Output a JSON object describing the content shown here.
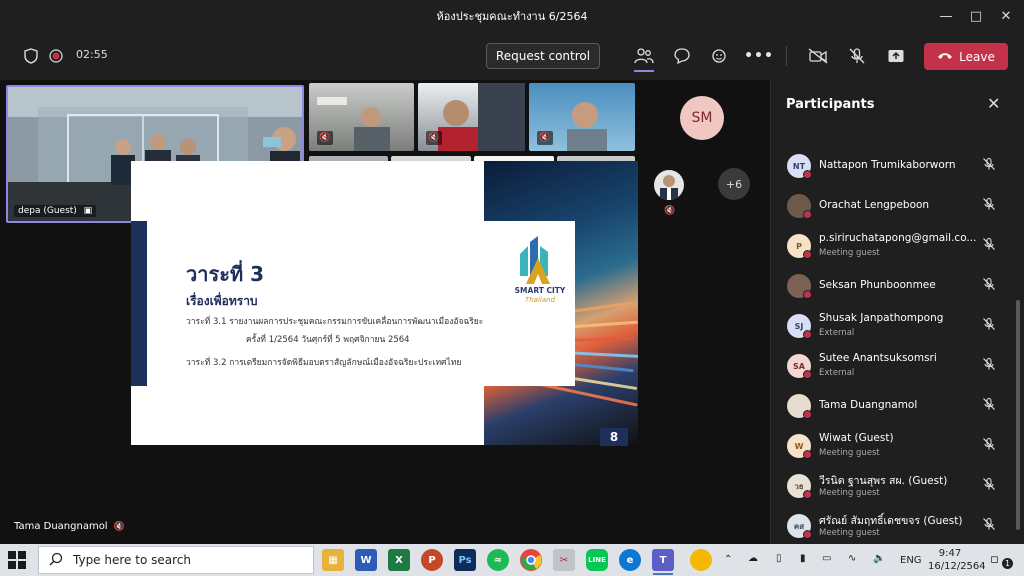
{
  "window": {
    "title": "ห้องประชุมคณะทำงาน 6/2564",
    "minimize_icon": "minimize-icon",
    "maximize_icon": "maximize-icon",
    "close_icon": "close-icon"
  },
  "toolbar": {
    "timer": "02:55",
    "request_control": "Request control",
    "leave": "Leave"
  },
  "stage": {
    "main_tile_label": "depa (Guest)",
    "avatar_initials": "SM",
    "overflow_count": "+6",
    "presenter_name": "Tama Duangnamol"
  },
  "slide": {
    "agenda_title": "วาระที่ 3",
    "agenda_subtitle": "เรื่องเพื่อทราบ",
    "line1": "วาระที่ 3.1 รายงานผลการประชุมคณะกรรมการขับเคลื่อนการพัฒนาเมืองอัจฉริยะ",
    "line2": "ครั้งที่ 1/2564 วันศุกร์ที่ 5 พฤศจิกายน 2564",
    "line3": "วาระที่ 3.2 การเตรียมการจัดพิธีมอบตราสัญลักษณ์เมืองอัจฉริยะประเทศไทย",
    "logo_text": "SMART CITY",
    "logo_subtext": "Thailand",
    "page_number": "8"
  },
  "panel": {
    "title": "Participants",
    "participants": [
      {
        "initials": "NT",
        "name": "Nattapon Trumikaborworn",
        "sub": "",
        "avatar_color": "#d9e0f5",
        "text_color": "#33406a"
      },
      {
        "initials": "",
        "name": "Orachat Lengpeboon",
        "sub": "",
        "avatar_color": "#6d5a4a",
        "text_color": "#fff"
      },
      {
        "initials": "P",
        "name": "p.siriruchatapong@gmail.co...",
        "sub": "Meeting guest",
        "avatar_color": "#f7e2c7",
        "text_color": "#8a5a1a"
      },
      {
        "initials": "",
        "name": "Seksan Phunboonmee",
        "sub": "",
        "avatar_color": "#7b6252",
        "text_color": "#fff"
      },
      {
        "initials": "SJ",
        "name": "Shusak Janpathompong",
        "sub": "External",
        "avatar_color": "#d9e0f5",
        "text_color": "#33406a"
      },
      {
        "initials": "SA",
        "name": "Sutee Anantsuksomsri",
        "sub": "External",
        "avatar_color": "#f4d6d3",
        "text_color": "#7b2a2a"
      },
      {
        "initials": "",
        "name": "Tama Duangnamol",
        "sub": "",
        "avatar_color": "#e7dccf",
        "text_color": "#333"
      },
      {
        "initials": "W",
        "name": "Wiwat (Guest)",
        "sub": "Meeting guest",
        "avatar_color": "#f7e2c7",
        "text_color": "#8a5a1a"
      },
      {
        "initials": "วธ",
        "name": "วีรนิต ฐานสุพร สผ. (Guest)",
        "sub": "Meeting guest",
        "avatar_color": "#e9e1d6",
        "text_color": "#5a4a3a"
      },
      {
        "initials": "คส",
        "name": "ศรัณย์ สัมฤทธิ์เดชขจร (Guest)",
        "sub": "Meeting guest",
        "avatar_color": "#dfe3ea",
        "text_color": "#3a4a5a"
      }
    ]
  },
  "taskbar": {
    "search_placeholder": "Type here to search",
    "language": "ENG",
    "time": "9:47",
    "date": "16/12/2564",
    "notification_count": "1"
  }
}
